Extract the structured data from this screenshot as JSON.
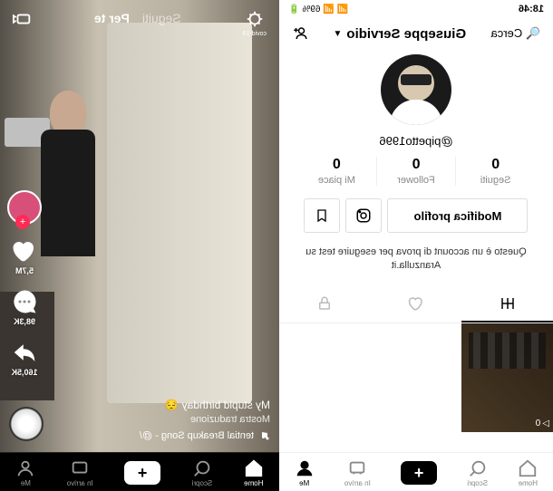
{
  "status": {
    "time": "18:46",
    "battery": "69%"
  },
  "profile": {
    "search": "Cerca",
    "name": "Giuseppe Servidio",
    "handle": "@pipetto1996",
    "stats": {
      "following": {
        "val": "0",
        "lbl": "Seguiti"
      },
      "followers": {
        "val": "0",
        "lbl": "Follower"
      },
      "likes": {
        "val": "0",
        "lbl": "Mi piace"
      }
    },
    "edit_btn": "Modifica profilo",
    "bio": "Questo è un account di prova per eseguire test su Aranzulla.it",
    "video_views": "0"
  },
  "nav": {
    "home": "Home",
    "discover": "Scopri",
    "inbox": "In arrivo",
    "me": "Me"
  },
  "feed": {
    "covid": "covid-19",
    "following": "Seguiti",
    "foryou": "Per te",
    "likes": "5,7M",
    "comments": "98,3K",
    "shares": "160,5K",
    "caption": "My stupid birthday",
    "translate": "Mostra traduzione",
    "music": "tential Breakup Song - @/"
  }
}
